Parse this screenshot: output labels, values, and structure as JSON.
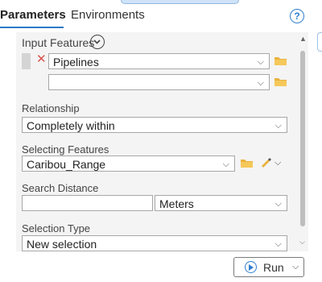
{
  "tabs": [
    {
      "label": "Parameters",
      "active": true
    },
    {
      "label": "Environments",
      "active": false
    }
  ],
  "help_icon": "help-circle-icon",
  "input_features": {
    "label": "Input Features",
    "rows": [
      {
        "value": "Pipelines"
      },
      {
        "value": ""
      }
    ]
  },
  "relationship": {
    "label": "Relationship",
    "value": "Completely within"
  },
  "selecting_features": {
    "label": "Selecting Features",
    "value": "Caribou_Range"
  },
  "search_distance": {
    "label": "Search Distance",
    "value": "",
    "unit": "Meters"
  },
  "selection_type": {
    "label": "Selection Type",
    "value": "New selection"
  },
  "run": {
    "label": "Run"
  },
  "colors": {
    "accent": "#2f7fd1",
    "remove": "#d9534f",
    "folder": "#e9b23f"
  }
}
